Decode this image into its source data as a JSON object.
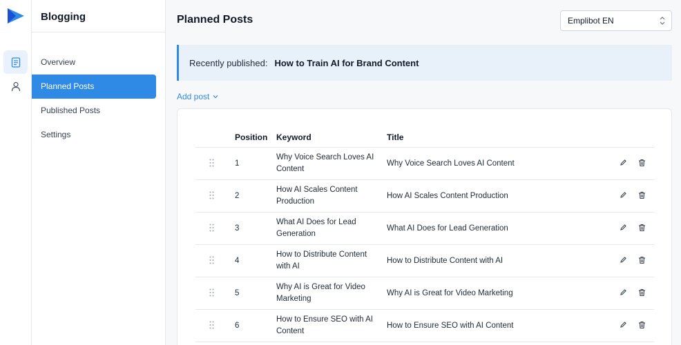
{
  "app": {
    "section_title": "Blogging"
  },
  "sidebar": {
    "items": [
      {
        "label": "Overview",
        "active": false
      },
      {
        "label": "Planned Posts",
        "active": true
      },
      {
        "label": "Published Posts",
        "active": false
      },
      {
        "label": "Settings",
        "active": false
      }
    ]
  },
  "header": {
    "title": "Planned Posts",
    "bot_select": "Emplibot EN"
  },
  "banner": {
    "label": "Recently published:",
    "value": "How to Train AI for Brand Content"
  },
  "toolbar": {
    "add_post_label": "Add post"
  },
  "table": {
    "columns": [
      "Position",
      "Keyword",
      "Title"
    ],
    "rows": [
      {
        "position": "1",
        "keyword": "Why Voice Search Loves AI Content",
        "title": "Why Voice Search Loves AI Content"
      },
      {
        "position": "2",
        "keyword": "How AI Scales Content Production",
        "title": "How AI Scales Content Production"
      },
      {
        "position": "3",
        "keyword": "What AI Does for Lead Generation",
        "title": "What AI Does for Lead Generation"
      },
      {
        "position": "4",
        "keyword": "How to Distribute Content with AI",
        "title": "How to Distribute Content with AI"
      },
      {
        "position": "5",
        "keyword": "Why AI is Great for Video Marketing",
        "title": "Why AI is Great for Video Marketing"
      },
      {
        "position": "6",
        "keyword": "How to Ensure SEO with AI Content",
        "title": "How to Ensure SEO with AI Content"
      }
    ]
  },
  "icons": {
    "logo": "play-logo-icon",
    "rail": [
      "document-icon",
      "user-icon"
    ],
    "row_actions": [
      "pencil-icon",
      "trash-icon"
    ],
    "drag": "drag-handle-icon"
  },
  "colors": {
    "accent": "#2f8ae5",
    "banner_bg": "#e8f1fa"
  }
}
